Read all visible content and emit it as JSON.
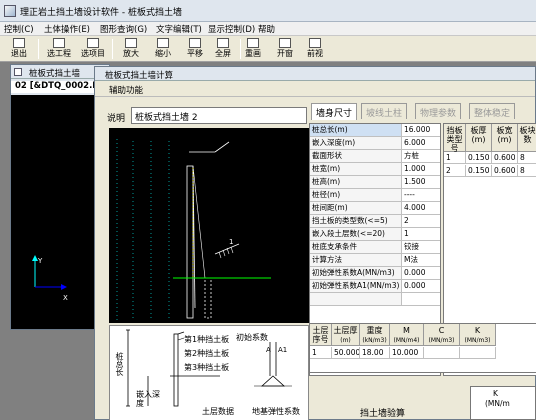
{
  "app": {
    "title": "理正岩土挡土墙设计软件 - 桩板式挡土墙"
  },
  "menu": [
    "控制(C)",
    "土体操作(E)",
    "图形查询(G)",
    "文字编辑(T)",
    "显示控制(D)",
    "帮助"
  ],
  "toolbar": [
    {
      "label": "退出",
      "icon": "exit-icon"
    },
    {
      "label": "选工程",
      "icon": "select-project-icon"
    },
    {
      "label": "选项目",
      "icon": "select-item-icon"
    },
    {
      "label": "放大",
      "icon": "zoom-in-icon"
    },
    {
      "label": "缩小",
      "icon": "zoom-out-icon"
    },
    {
      "label": "平移",
      "icon": "pan-icon"
    },
    {
      "label": "全屏",
      "icon": "fullscreen-icon"
    },
    {
      "label": "重画",
      "icon": "redraw-icon"
    },
    {
      "label": "开窗",
      "icon": "window-icon"
    },
    {
      "label": "前视",
      "icon": "front-view-icon"
    }
  ],
  "child_window": {
    "title": "桩板式挡土墙",
    "file": "02 [&DTQ_0002.D"
  },
  "dialog": {
    "title": "桩板式挡土墙计算",
    "menu_item": "辅助功能",
    "desc_label": "说明",
    "desc_value": "桩板式挡土墙 2",
    "tabs": [
      {
        "label": "墙身尺寸",
        "state": "active"
      },
      {
        "label": "坡线土柱",
        "state": "disabled"
      },
      {
        "label": "物理参数",
        "state": "disabled"
      },
      {
        "label": "整体稳定",
        "state": "disabled"
      }
    ],
    "params": [
      {
        "name": "桩总长(m)",
        "value": "16.000"
      },
      {
        "name": "嵌入深度(m)",
        "value": "6.000"
      },
      {
        "name": "截面形状",
        "value": "方桩"
      },
      {
        "name": "桩宽(m)",
        "value": "1.000"
      },
      {
        "name": "桩高(m)",
        "value": "1.500"
      },
      {
        "name": "桩径(m)",
        "value": "----"
      },
      {
        "name": "桩间距(m)",
        "value": "4.000"
      },
      {
        "name": "挡土板的类型数(<=5)",
        "value": "2"
      },
      {
        "name": "嵌入段土层数(<=20)",
        "value": "1"
      },
      {
        "name": "桩底支承条件",
        "value": "铰接"
      },
      {
        "name": "计算方法",
        "value": "M法"
      },
      {
        "name": "初始弹性系数A(MN/m3)",
        "value": "0.000"
      },
      {
        "name": "初始弹性系数A1(MN/m3)",
        "value": "0.000"
      }
    ],
    "plate_table": {
      "headers": [
        "挡板类型号",
        "板厚(m)",
        "板宽(m)",
        "板块数"
      ],
      "rows": [
        [
          "1",
          "0.150",
          "0.600",
          "8"
        ],
        [
          "2",
          "0.150",
          "0.600",
          "8"
        ]
      ]
    },
    "soil_table": {
      "headers": [
        {
          "label": "土层序号",
          "unit": ""
        },
        {
          "label": "土层厚",
          "unit": "(m)"
        },
        {
          "label": "重度",
          "unit": "(kN/m3)"
        },
        {
          "label": "M",
          "unit": "(MN/m4)"
        },
        {
          "label": "C",
          "unit": "(MN/m3)"
        },
        {
          "label": "K",
          "unit": "(MN/m3)"
        }
      ],
      "rows": [
        [
          "1",
          "50.000",
          "18.00",
          "10.000",
          "",
          ""
        ]
      ]
    },
    "sketch_labels": {
      "length": "桩总长",
      "embed": "嵌入深度",
      "plate1": "第1种挡土板",
      "plate2": "第2种挡土板",
      "plate3": "第3种挡土板",
      "initial": "初始系数",
      "layer": "土层数据",
      "foundation": "地基弹性系数",
      "a": "A",
      "a1": "A1"
    },
    "bottom_title": "挡土墙验算"
  },
  "mini_window": {
    "k_label": "K",
    "k_unit": "(MN/m"
  },
  "colors": {
    "canvas_bg": "#000000",
    "wall": "#ffffff",
    "soil_line": "#00ff00",
    "dim_line": "#ffff00",
    "axis_x": "#0000ff",
    "axis_y": "#00ffff",
    "selection": "#cfe0f3"
  }
}
